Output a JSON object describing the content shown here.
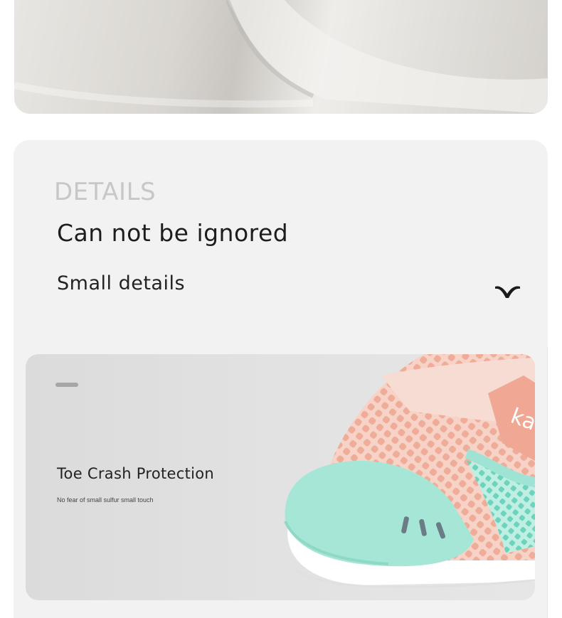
{
  "fabric": {
    "image": "fabric-closeup"
  },
  "details": {
    "eyebrow": "DETAILS",
    "headline": "Can not be ignored",
    "subhead": "Small details",
    "icon": "chevron-down-icon"
  },
  "feature": {
    "title": "Toe Crash Protection",
    "description": "No fear of small sulfur small touch",
    "brand_text": "kat",
    "image": "baby-shoe-toe"
  },
  "colors": {
    "card_bg": "#f2f2f2",
    "feature_bg": "#dedede",
    "shoe_mesh": "#f4c6b8",
    "shoe_toe": "#9fe3d5",
    "shoe_strap": "#f0b3a3"
  }
}
